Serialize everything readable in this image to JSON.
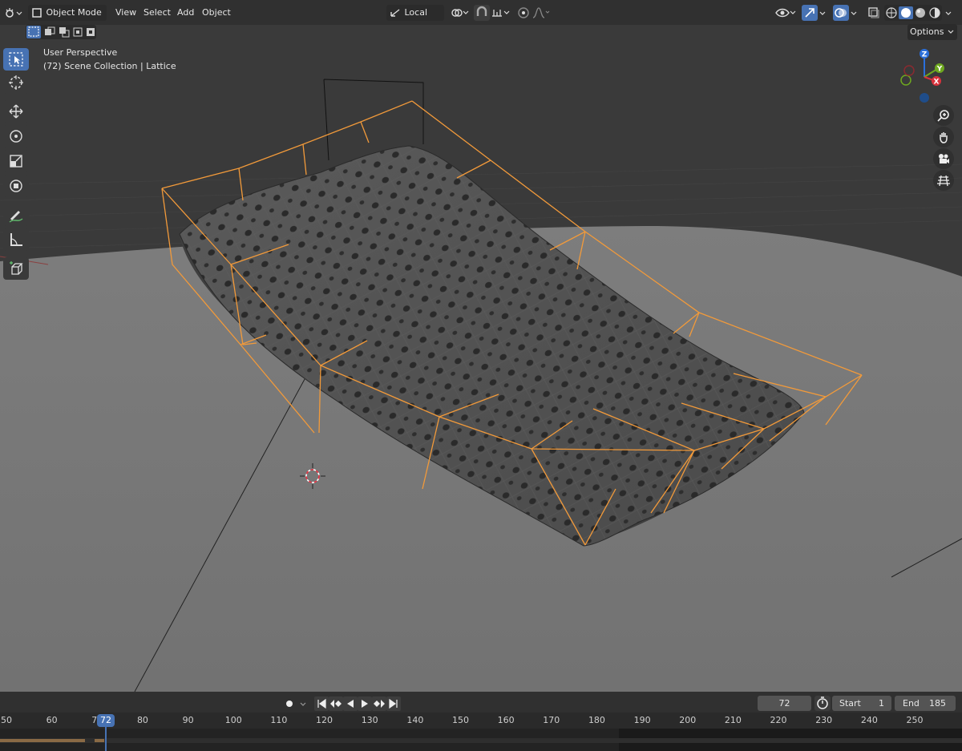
{
  "header": {
    "mode": "Object Mode",
    "menus": [
      "View",
      "Select",
      "Add",
      "Object"
    ],
    "transform_orientation": "Local",
    "options_label": "Options"
  },
  "viewport": {
    "view_name": "User Perspective",
    "collection_info": "(72) Scene Collection | Lattice"
  },
  "gizmo": {
    "z": "Z",
    "y": "Y",
    "x": "X"
  },
  "toolbar": {
    "tools": [
      "select-box",
      "cursor",
      "move",
      "rotate",
      "scale",
      "transform",
      "annotate",
      "measure",
      "add-cube"
    ]
  },
  "navigation": [
    "zoom",
    "pan",
    "camera",
    "ortho-grid"
  ],
  "playback": {
    "current_frame": "72",
    "start_label": "Start",
    "start_value": "1",
    "end_label": "End",
    "end_value": "185"
  },
  "timeline": {
    "current_frame": 72,
    "ticks": [
      "50",
      "60",
      "70",
      "80",
      "90",
      "100",
      "110",
      "120",
      "130",
      "140",
      "150",
      "160",
      "170",
      "180",
      "190",
      "200",
      "210",
      "220",
      "230",
      "240",
      "250"
    ]
  },
  "colors": {
    "accent": "#4772b3",
    "lattice": "#f29a3a",
    "header_bg": "#303030",
    "viewport_dark": "#3a3a3a",
    "floor": "#7a7a7a"
  }
}
